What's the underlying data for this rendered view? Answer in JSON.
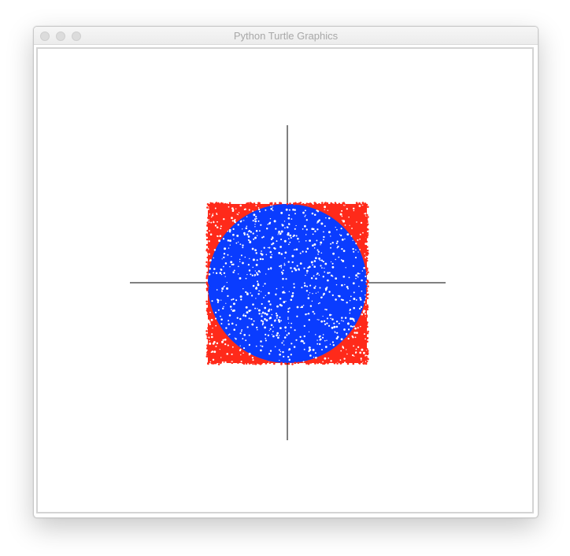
{
  "window": {
    "title": "Python Turtle Graphics"
  },
  "drawing": {
    "square_color": "#ff2a1a",
    "circle_color": "#0a3cff",
    "axis_color": "#000000",
    "background_color": "#ffffff"
  }
}
